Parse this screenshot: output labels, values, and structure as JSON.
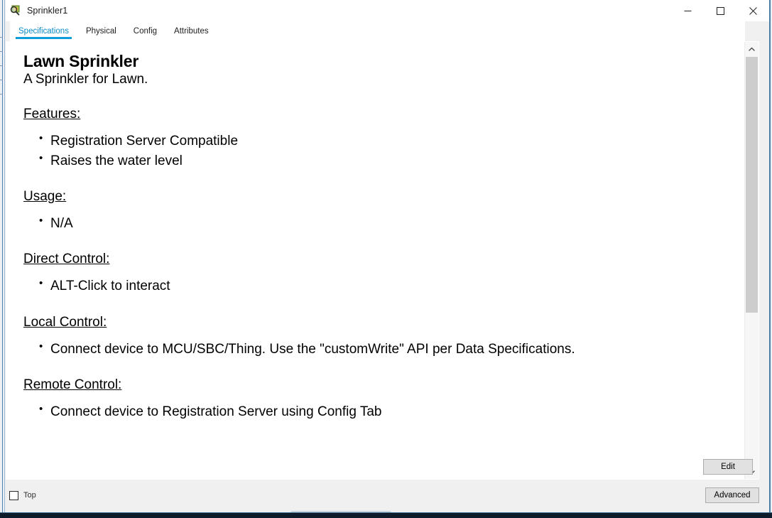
{
  "window": {
    "title": "Sprinkler1",
    "icon": "inspect-device-icon",
    "controls": {
      "minimize": "minimize-icon",
      "maximize": "maximize-icon",
      "close": "close-icon"
    }
  },
  "tabs": [
    {
      "label": "Specifications",
      "active": true
    },
    {
      "label": "Physical",
      "active": false
    },
    {
      "label": "Config",
      "active": false
    },
    {
      "label": "Attributes",
      "active": false
    }
  ],
  "document": {
    "title": "Lawn Sprinkler",
    "subtitle": "A Sprinkler for Lawn.",
    "sections": [
      {
        "heading": "Features:",
        "items": [
          "Registration Server Compatible",
          "Raises the water level"
        ]
      },
      {
        "heading": "Usage:",
        "items": [
          "N/A"
        ]
      },
      {
        "heading": "Direct Control:",
        "items": [
          "ALT-Click to interact"
        ]
      },
      {
        "heading": "Local Control:",
        "items": [
          "Connect device to MCU/SBC/Thing. Use the \"customWrite\" API per Data Specifications."
        ]
      },
      {
        "heading": "Remote Control:",
        "items": [
          "Connect device to Registration Server using Config Tab"
        ]
      }
    ]
  },
  "scrollbar": {
    "up_arrow": "chevron-up-icon",
    "down_arrow": "chevron-down-icon"
  },
  "buttons": {
    "edit": "Edit",
    "advanced": "Advanced"
  },
  "footer": {
    "top_checkbox_label": "Top",
    "top_checkbox_checked": false
  },
  "colors": {
    "accent": "#0d9ddb",
    "active_tab_text": "#0d8bc4",
    "window_bg": "#f0f0f0",
    "panel_bg": "#ffffff",
    "button_bg": "#e1e1e1",
    "scroll_thumb": "#cdcdcd"
  }
}
